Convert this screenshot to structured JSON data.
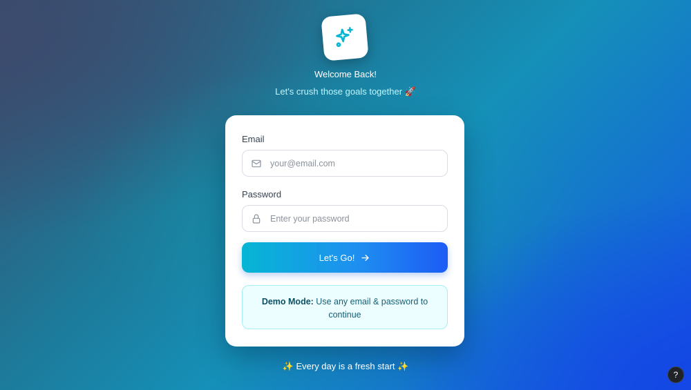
{
  "header": {
    "logo_icon": "sparkles-icon",
    "title": "Welcome Back!",
    "tagline": "Let's crush those goals together 🚀"
  },
  "form": {
    "email": {
      "label": "Email",
      "icon": "mail-icon",
      "value": "",
      "placeholder": "your@email.com"
    },
    "password": {
      "label": "Password",
      "icon": "lock-icon",
      "value": "",
      "placeholder": "Enter your password"
    },
    "submit": {
      "label": "Let's Go!",
      "icon": "arrow-right-icon"
    },
    "demo_notice": {
      "bold": "Demo Mode:",
      "text": " Use any email & password to continue"
    }
  },
  "footer": {
    "text": "✨ Every day is a fresh start ✨"
  },
  "help_button": {
    "label": "?"
  },
  "colors": {
    "accent_start": "#06b6d4",
    "accent_end": "#1d5cf5",
    "card_bg": "#ffffff",
    "demo_bg": "#ecfeff"
  }
}
